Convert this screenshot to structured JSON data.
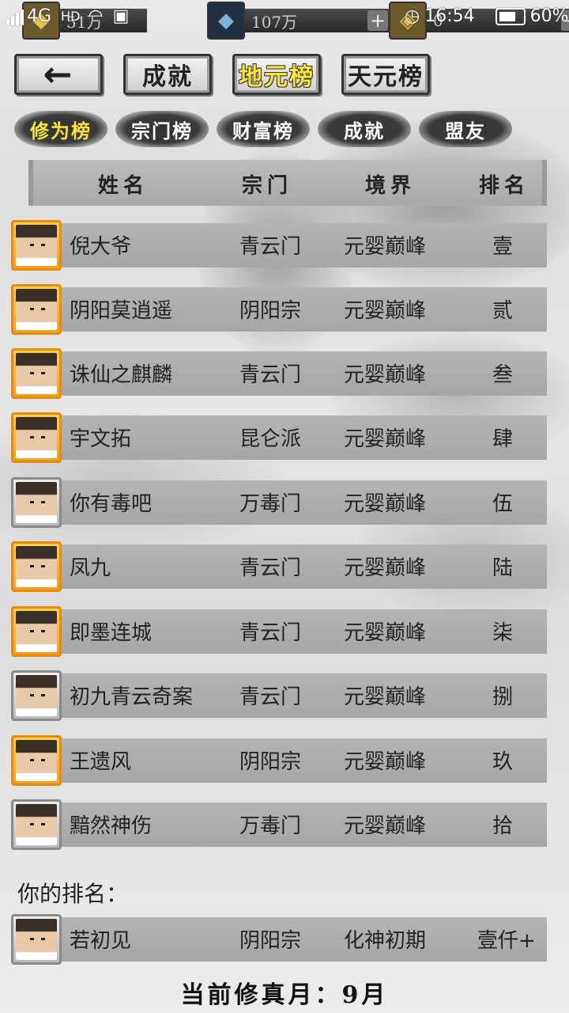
{
  "status_bar": {
    "network": "4G",
    "hd": "HD",
    "time": "16:54",
    "battery": "60%"
  },
  "resources": [
    {
      "icon": "gold-ingot-icon",
      "value": "51万"
    },
    {
      "icon": "spirit-stone-icon",
      "value": "107万"
    },
    {
      "icon": "gold-token-icon",
      "value": "0"
    }
  ],
  "top_buttons": {
    "back": "←",
    "achievements": "成就",
    "earth_ranking": "地元榜",
    "heaven_ranking": "天元榜"
  },
  "tabs": [
    {
      "label": "修为榜",
      "active": true
    },
    {
      "label": "宗门榜",
      "active": false
    },
    {
      "label": "财富榜",
      "active": false
    },
    {
      "label": "成就",
      "active": false
    },
    {
      "label": "盟友",
      "active": false
    }
  ],
  "table": {
    "headers": {
      "name": "姓名",
      "sect": "宗门",
      "realm": "境界",
      "rank": "排名"
    },
    "rows": [
      {
        "name": "倪大爷",
        "sect": "青云门",
        "realm": "元婴巅峰",
        "rank": "壹",
        "frame": "gold"
      },
      {
        "name": "阴阳莫逍遥",
        "sect": "阴阳宗",
        "realm": "元婴巅峰",
        "rank": "贰",
        "frame": "gold"
      },
      {
        "name": "诛仙之麒麟",
        "sect": "青云门",
        "realm": "元婴巅峰",
        "rank": "叁",
        "frame": "gold"
      },
      {
        "name": "宇文拓",
        "sect": "昆仑派",
        "realm": "元婴巅峰",
        "rank": "肆",
        "frame": "gold"
      },
      {
        "name": "你有毒吧",
        "sect": "万毒门",
        "realm": "元婴巅峰",
        "rank": "伍",
        "frame": "silver"
      },
      {
        "name": "凤九",
        "sect": "青云门",
        "realm": "元婴巅峰",
        "rank": "陆",
        "frame": "gold"
      },
      {
        "name": "即墨连城",
        "sect": "青云门",
        "realm": "元婴巅峰",
        "rank": "柒",
        "frame": "gold"
      },
      {
        "name": "初九青云奇案",
        "sect": "青云门",
        "realm": "元婴巅峰",
        "rank": "捌",
        "frame": "silver"
      },
      {
        "name": "王遗风",
        "sect": "阴阳宗",
        "realm": "元婴巅峰",
        "rank": "玖",
        "frame": "gold"
      },
      {
        "name": "黯然神伤",
        "sect": "万毒门",
        "realm": "元婴巅峰",
        "rank": "拾",
        "frame": "silver"
      }
    ]
  },
  "your_rank": {
    "label": "你的排名：",
    "name": "若初见",
    "sect": "阴阳宗",
    "realm": "化神初期",
    "rank": "壹仟+",
    "frame": "silver"
  },
  "footer": "当前修真月：9月"
}
